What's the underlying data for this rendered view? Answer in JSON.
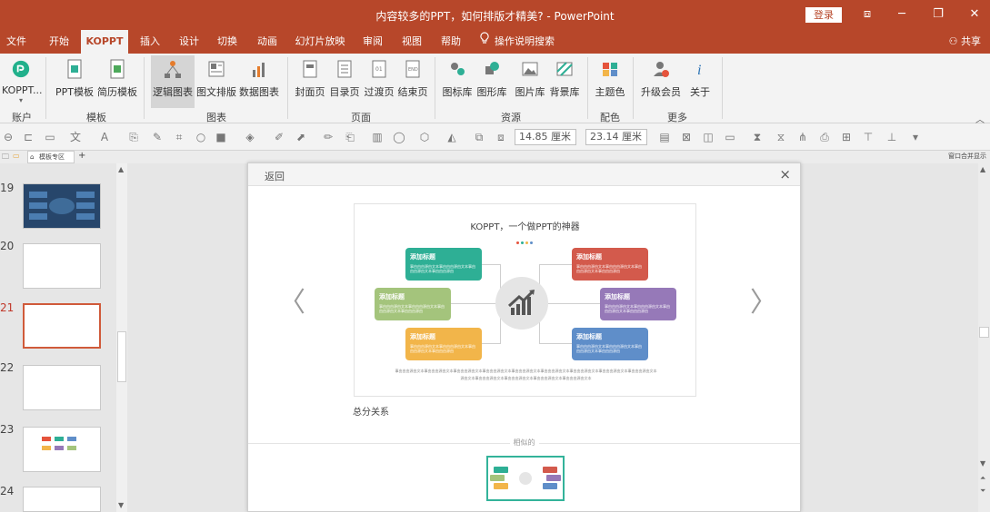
{
  "window": {
    "title": "内容较多的PPT，如何排版才精美?  -  PowerPoint",
    "login_label": "登录",
    "controls": [
      "⧈",
      "─",
      "❐",
      "✕"
    ]
  },
  "menu": {
    "tabs": [
      "文件",
      "开始",
      "KOPPT",
      "插入",
      "设计",
      "切换",
      "动画",
      "幻灯片放映",
      "审阅",
      "视图",
      "帮助",
      "操作说明搜索"
    ],
    "active_tab": "KOPPT",
    "share_label": "共享"
  },
  "ribbon": {
    "items": [
      "KOPPT...",
      "PPT模板",
      "简历模板",
      "逻辑图表",
      "图文排版",
      "数据图表",
      "封面页",
      "目录页",
      "过渡页",
      "结束页",
      "图标库",
      "图形库",
      "图片库",
      "背景库",
      "主题色",
      "升级会员",
      "关于"
    ],
    "selected": "逻辑图表",
    "groups": [
      "账户",
      "模板",
      "图表",
      "页面",
      "资源",
      "配色",
      "更多"
    ]
  },
  "format_toolbar": {
    "width_value": "14.85 厘米",
    "height_value": "23.14 厘米"
  },
  "tab_strip": {
    "doc_tab_label": "模板专区",
    "add_label": "+",
    "right_label": "窗口合并显示"
  },
  "slides": {
    "numbers": [
      "19",
      "20",
      "21",
      "22",
      "23",
      "24"
    ],
    "active": "21"
  },
  "dialog": {
    "back_label": "返回",
    "close_label": "×",
    "prev_arrow": "〈",
    "next_arrow": "〉",
    "preview_title": "KOPPT，一个做PPT的神器",
    "card_title": "添加标题",
    "card_body": "事由由由源由文本事由由由源由文本事由由由源由文本事由由由源由",
    "body_text_1": "事由由由源由文本事由由由源由文本事由由由源由文本事由由由源由文本事由由由源由文本事由由由源由文本事由由由源由文本事由由由源由文本事由由由源由文本",
    "body_text_2": "源由文本事由由由源由文本事由由由源由文本事由由由源由文本事由由由源由文本",
    "caption": "总分关系",
    "related_label": "相似的"
  },
  "colors": {
    "brand": "#b7472a",
    "teal": "#2eaf95",
    "red": "#d35a4c",
    "green": "#a4c47c",
    "purple": "#9679b8",
    "orange": "#f2b54a",
    "blue": "#5f8ec9"
  }
}
